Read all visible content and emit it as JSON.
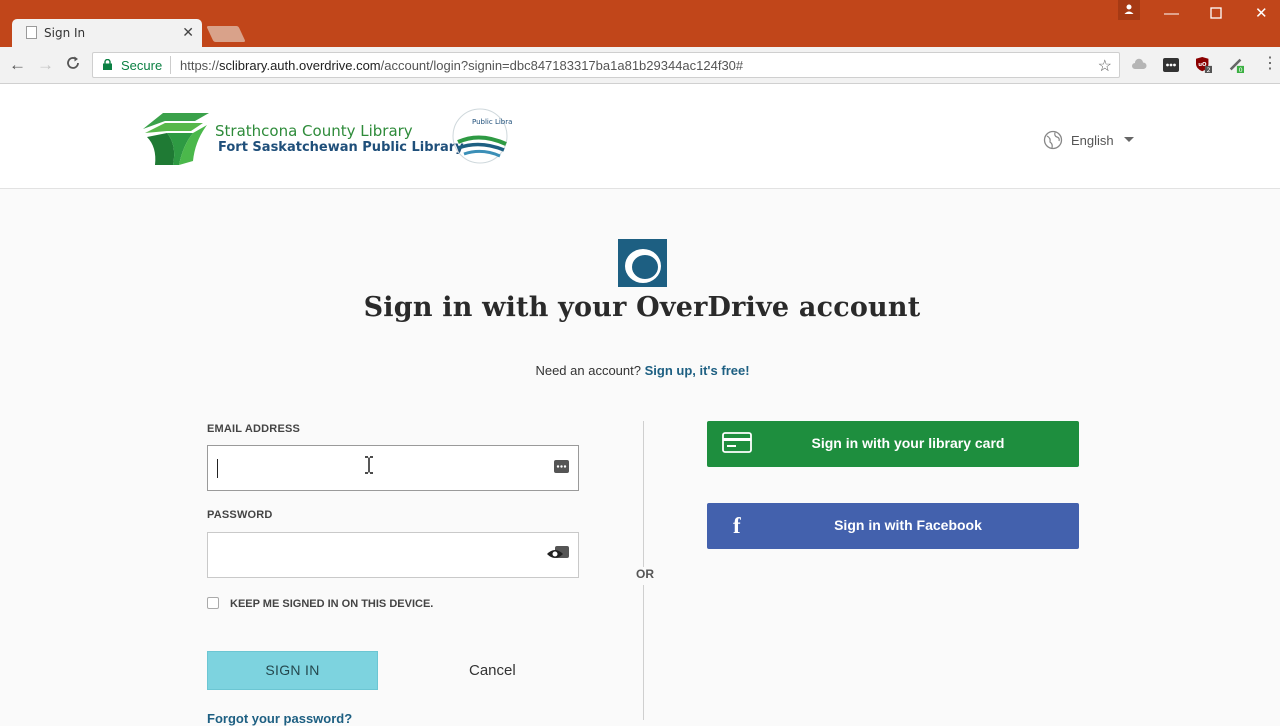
{
  "browser": {
    "tab_title": "Sign In",
    "secure_label": "Secure",
    "url_scheme": "https://",
    "url_host": "sclibrary.auth.overdrive.com",
    "url_path": "/account/login?signin=dbc847183317ba1a81b29344ac124f30#"
  },
  "header": {
    "library_name_line1": "Strathcona County Library",
    "library_name_line2": "Fort Saskatchewan Public Library",
    "seal_text": "Public Library",
    "language": "English"
  },
  "signin": {
    "title": "Sign in with your OverDrive account",
    "need_account_text": "Need an account?",
    "signup_link": "Sign up, it's free!",
    "email_label": "EMAIL ADDRESS",
    "email_value": "",
    "password_label": "PASSWORD",
    "password_value": "",
    "keep_signed_in_label": "KEEP ME SIGNED IN ON THIS DEVICE.",
    "keep_signed_in_checked": false,
    "signin_button": "SIGN IN",
    "cancel_button": "Cancel",
    "forgot_link": "Forgot your password?",
    "or_label": "OR",
    "library_card_button": "Sign in with your library card",
    "facebook_button": "Sign in with Facebook"
  },
  "colors": {
    "titlebar": "#c1461a",
    "brand_blue": "#1d5f82",
    "card_button": "#1e8e3e",
    "facebook_button": "#4361ad",
    "signin_button": "#7dd3df"
  }
}
